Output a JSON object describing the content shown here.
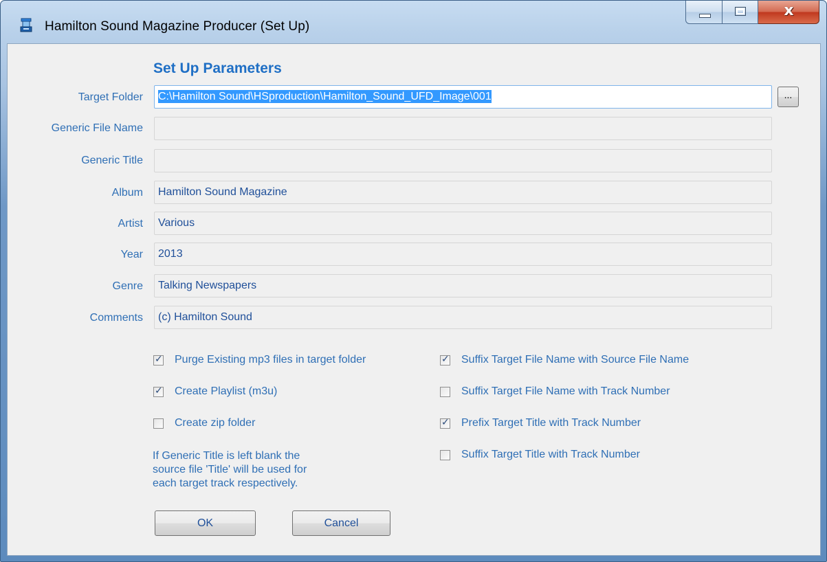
{
  "window": {
    "title": "Hamilton Sound Magazine Producer (Set Up)",
    "close_glyph": "x"
  },
  "heading": "Set Up Parameters",
  "fields": [
    {
      "label": "Target Folder",
      "value": "C:\\Hamilton Sound\\HSproduction\\Hamilton_Sound_UFD_Image\\001"
    },
    {
      "label": "Generic File Name",
      "value": ""
    },
    {
      "label": "Generic Title",
      "value": ""
    },
    {
      "label": "Album",
      "value": "Hamilton Sound Magazine"
    },
    {
      "label": "Artist",
      "value": "Various"
    },
    {
      "label": "Year",
      "value": "2013"
    },
    {
      "label": "Genre",
      "value": "Talking Newspapers"
    },
    {
      "label": "Comments",
      "value": "(c) Hamilton Sound"
    }
  ],
  "browse_label": "...",
  "options_left": [
    {
      "label": "Purge Existing mp3 files in target folder",
      "checked": true
    },
    {
      "label": "Create Playlist (m3u)",
      "checked": true
    },
    {
      "label": "Create zip folder",
      "checked": false
    }
  ],
  "options_right": [
    {
      "label": "Suffix Target File Name with Source File Name",
      "checked": true
    },
    {
      "label": "Suffix Target File Name with Track Number",
      "checked": false
    },
    {
      "label": "Prefix Target Title with Track Number",
      "checked": true
    },
    {
      "label": "Suffix Target Title with Track Number",
      "checked": false
    }
  ],
  "note_lines": [
    "If Generic Title is left blank the",
    "source file 'Title' will be used for",
    "each target track respectively."
  ],
  "buttons": {
    "ok": "OK",
    "cancel": "Cancel"
  },
  "check_glyph": "✓",
  "colors": {
    "label": "#2f6fb5",
    "heading": "#1f6fc5",
    "selection": "#3399ff"
  }
}
